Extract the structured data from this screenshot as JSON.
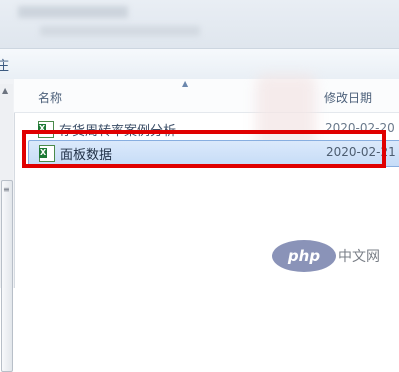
{
  "toolbar": {
    "edge_char": "庄"
  },
  "header": {
    "name_label": "名称",
    "date_label": "修改日期"
  },
  "files": [
    {
      "name": "存货周转率案例分析",
      "date": "2020-02-20",
      "icon": "excel-file-icon",
      "selected": false
    },
    {
      "name": "面板数据",
      "date": "2020-02-21",
      "icon": "excel-file-icon",
      "selected": true
    }
  ],
  "watermark": {
    "logo": "php",
    "text": "中文网"
  },
  "colors": {
    "highlight_frame": "#e00000",
    "selection": "#cfe1f8"
  }
}
